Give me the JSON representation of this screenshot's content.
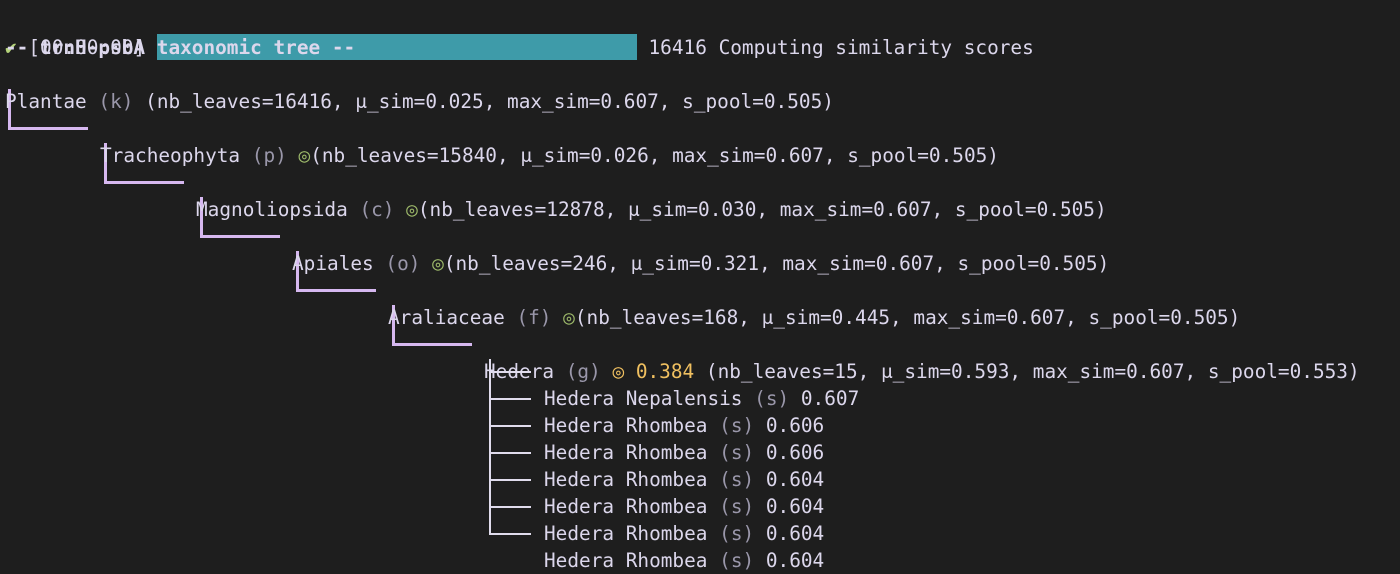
{
  "progress": {
    "check": "✔",
    "elapsed": "[00:00:00]",
    "count": "16416",
    "message": "Computing similarity scores",
    "fraction": 1.0,
    "bar_color": "#3e9ba9"
  },
  "tree_title": "-- trnH-psbA taxonomic tree --",
  "nodes": [
    {
      "name": "Plantae",
      "rank": "(k)",
      "marker": "",
      "score": "",
      "stats": "(nb_leaves=16416, μ_sim=0.025, max_sim=0.607, s_pool=0.505)"
    },
    {
      "name": "Tracheophyta",
      "rank": "(p)",
      "marker": "◎",
      "score": "",
      "stats": "(nb_leaves=15840, μ_sim=0.026, max_sim=0.607, s_pool=0.505)"
    },
    {
      "name": "Magnoliopsida",
      "rank": "(c)",
      "marker": "◎",
      "score": "",
      "stats": "(nb_leaves=12878, μ_sim=0.030, max_sim=0.607, s_pool=0.505)"
    },
    {
      "name": "Apiales",
      "rank": "(o)",
      "marker": "◎",
      "score": "",
      "stats": "(nb_leaves=246, μ_sim=0.321, max_sim=0.607, s_pool=0.505)"
    },
    {
      "name": "Araliaceae",
      "rank": "(f)",
      "marker": "◎",
      "score": "",
      "stats": "(nb_leaves=168, μ_sim=0.445, max_sim=0.607, s_pool=0.505)"
    },
    {
      "name": "Hedera",
      "rank": "(g)",
      "marker": "◎",
      "score": "0.384",
      "stats": "(nb_leaves=15, μ_sim=0.593, max_sim=0.607, s_pool=0.553)"
    }
  ],
  "species": [
    {
      "name": "Hedera Nepalensis",
      "rank": "(s)",
      "score": "0.607"
    },
    {
      "name": "Hedera Rhombea",
      "rank": "(s)",
      "score": "0.606"
    },
    {
      "name": "Hedera Rhombea",
      "rank": "(s)",
      "score": "0.606"
    },
    {
      "name": "Hedera Rhombea",
      "rank": "(s)",
      "score": "0.604"
    },
    {
      "name": "Hedera Rhombea",
      "rank": "(s)",
      "score": "0.604"
    },
    {
      "name": "Hedera Rhombea",
      "rank": "(s)",
      "score": "0.604"
    },
    {
      "name": "Hedera Rhombea",
      "rank": "(s)",
      "score": "0.604"
    }
  ],
  "colors": {
    "background": "#1e1e1e",
    "text": "#dcd7ec",
    "connector": "#d6b8f0",
    "target_marker": "#9db96a",
    "highlight_score": "#f0c060"
  }
}
